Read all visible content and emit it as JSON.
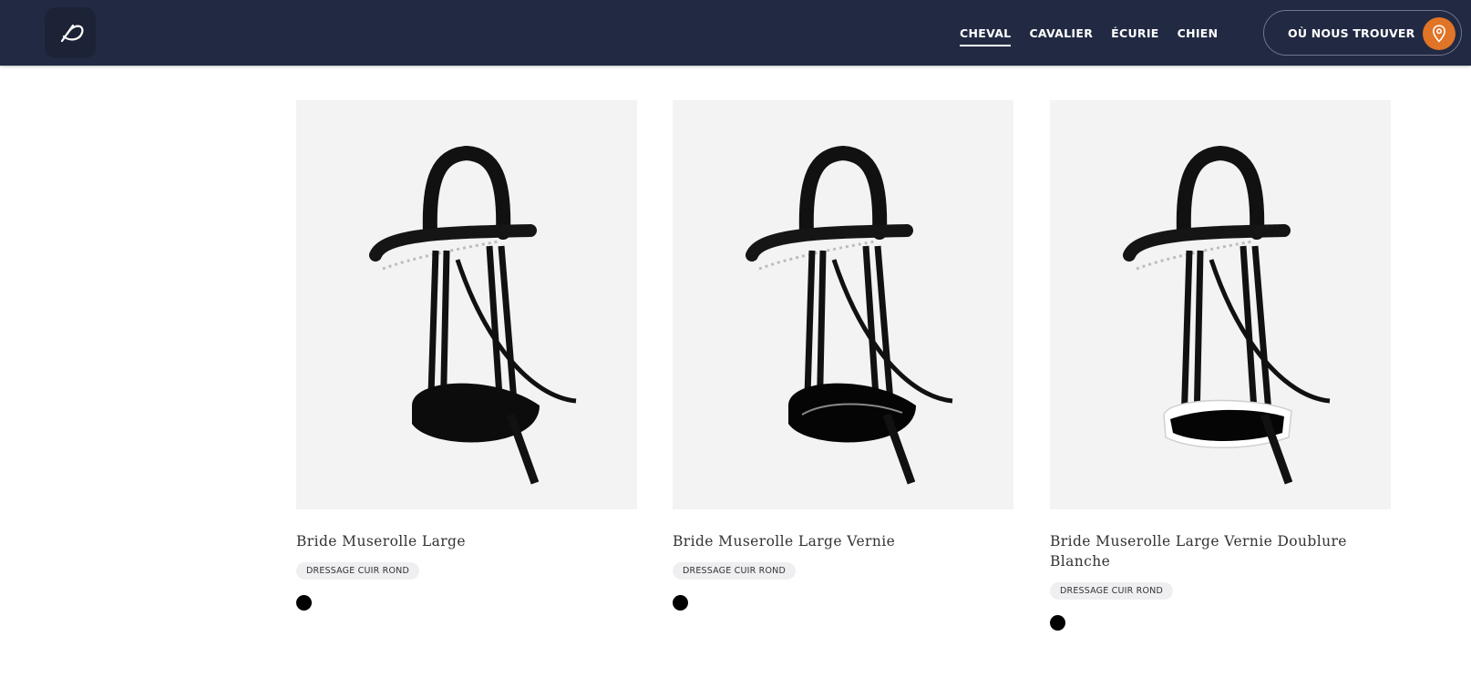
{
  "nav": {
    "links": [
      {
        "label": "CHEVAL",
        "active": true
      },
      {
        "label": "CAVALIER",
        "active": false
      },
      {
        "label": "ÉCURIE",
        "active": false
      },
      {
        "label": "CHIEN",
        "active": false
      }
    ],
    "find_label": "OÙ NOUS TROUVER"
  },
  "colors": {
    "navbar": "#222a43",
    "accent": "#e07427",
    "card_bg": "#f3f3f3"
  },
  "products": [
    {
      "title": "Bride Muserolle Large",
      "tag": "DRESSAGE CUIR ROND",
      "swatch": "#000000",
      "noseband": "black-matte"
    },
    {
      "title": "Bride Muserolle Large Vernie",
      "tag": "DRESSAGE CUIR ROND",
      "swatch": "#000000",
      "noseband": "black-patent"
    },
    {
      "title": "Bride Muserolle Large Vernie Doublure Blanche",
      "tag": "DRESSAGE CUIR ROND",
      "swatch": "#000000",
      "noseband": "patent-white-lining"
    }
  ],
  "icons": {
    "logo": "brand-logo-icon",
    "pin": "location-pin-icon"
  }
}
